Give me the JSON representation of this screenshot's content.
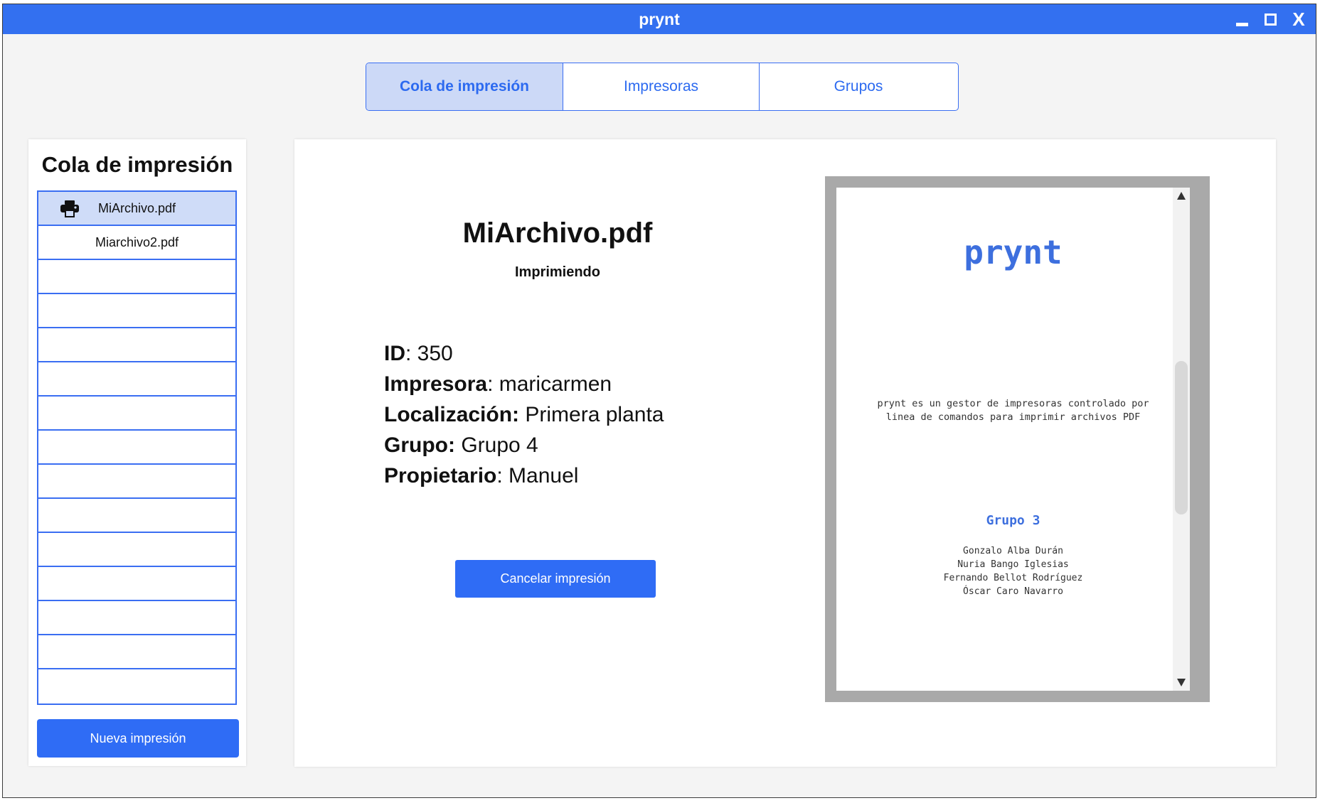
{
  "window": {
    "title": "prynt"
  },
  "tabs": [
    {
      "label": "Cola de impresión",
      "active": true
    },
    {
      "label": "Impresoras",
      "active": false
    },
    {
      "label": "Grupos",
      "active": false
    }
  ],
  "queue": {
    "title": "Cola de impresión",
    "items": [
      {
        "label": "MiArchivo.pdf",
        "icon": "printer-icon",
        "active": true
      },
      {
        "label": "Miarchivo2.pdf",
        "active": false
      },
      {
        "label": ""
      },
      {
        "label": ""
      },
      {
        "label": ""
      },
      {
        "label": ""
      },
      {
        "label": ""
      },
      {
        "label": ""
      },
      {
        "label": ""
      },
      {
        "label": ""
      },
      {
        "label": ""
      },
      {
        "label": ""
      },
      {
        "label": ""
      },
      {
        "label": ""
      },
      {
        "label": ""
      }
    ],
    "new_button": "Nueva impresión"
  },
  "detail": {
    "file_name": "MiArchivo.pdf",
    "status": "Imprimiendo",
    "props": [
      {
        "key": "ID",
        "sep": ": ",
        "value": "350"
      },
      {
        "key": "Impresora",
        "sep": ": ",
        "value": "maricarmen"
      },
      {
        "key": "Localización:",
        "sep": " ",
        "value": "Primera planta"
      },
      {
        "key": "Grupo:",
        "sep": " ",
        "value": "Grupo 4"
      },
      {
        "key": "Propietario",
        "sep": ": ",
        "value": "Manuel"
      }
    ],
    "cancel_button": "Cancelar impresión"
  },
  "preview": {
    "title": "prynt",
    "description_lines": [
      "prynt es un gestor de impresoras controlado por",
      "linea de comandos para imprimir archivos PDF"
    ],
    "group": "Grupo 3",
    "authors": [
      "Gonzalo Alba Durán",
      "Nuria Bango Iglesias",
      "Fernando Bellot Rodríguez",
      "Óscar Caro Navarro"
    ]
  },
  "colors": {
    "accent": "#3370f0",
    "active_tab_bg": "#ccd9f7",
    "active_row_bg": "#cfdcf8",
    "preview_title": "#3d6fde"
  }
}
